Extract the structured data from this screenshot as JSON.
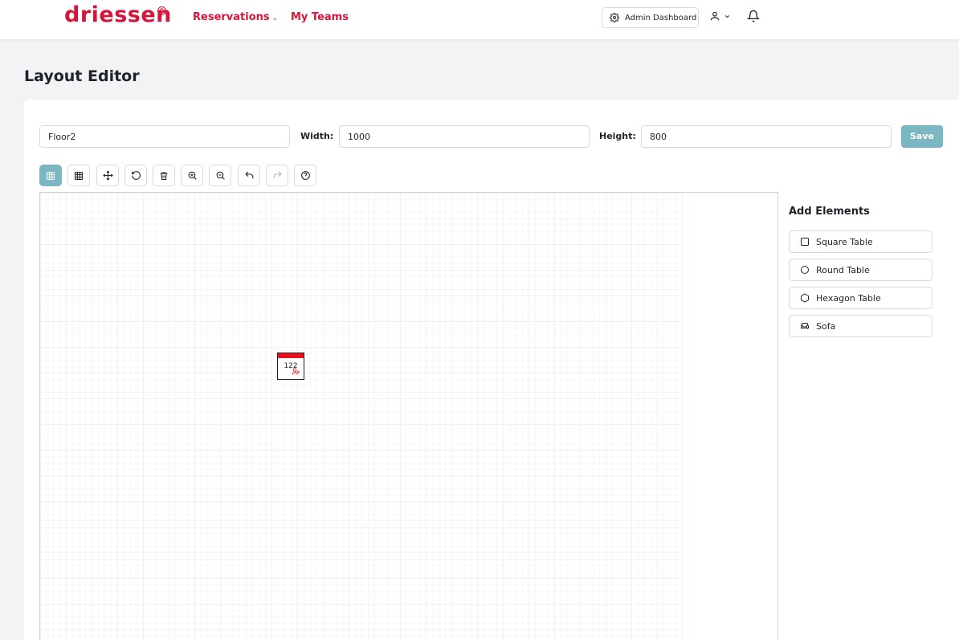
{
  "brand": {
    "name": "driessen",
    "reg_mark": "®",
    "color": "#d4163c"
  },
  "nav": {
    "reservations": "Reservations",
    "reservations_chevron": "⌄",
    "my_teams": "My Teams"
  },
  "header": {
    "admin_dashboard": "Admin Dashboard",
    "icons": [
      "gear-icon",
      "user-icon",
      "chevron-down-icon",
      "bell-icon"
    ]
  },
  "page": {
    "title": "Layout Editor"
  },
  "form": {
    "name_value": "Floor2",
    "width_label": "Width:",
    "width_value": "1000",
    "height_label": "Height:",
    "height_value": "800",
    "save_label": "Save"
  },
  "toolbar": {
    "tools": [
      "grid-icon",
      "snap-grid-icon",
      "move-icon",
      "rotate-icon",
      "trash-icon",
      "zoom-in-icon",
      "zoom-out-icon",
      "undo-icon",
      "redo-icon",
      "help-icon"
    ],
    "active_tool": "grid-icon"
  },
  "canvas": {
    "elements": [
      {
        "type": "square-table",
        "label": "122",
        "status_color": "#e8101f"
      }
    ]
  },
  "add_elements": {
    "title": "Add Elements",
    "items": [
      {
        "label": "Square Table",
        "icon": "square-icon"
      },
      {
        "label": "Round Table",
        "icon": "circle-icon"
      },
      {
        "label": "Hexagon Table",
        "icon": "hexagon-icon"
      },
      {
        "label": "Sofa",
        "icon": "sofa-icon"
      }
    ]
  },
  "colors": {
    "accent": "#7bb7c2",
    "brand": "#d4163c"
  }
}
